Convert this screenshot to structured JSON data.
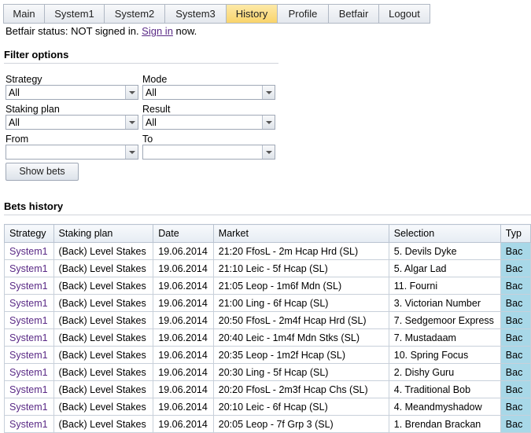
{
  "nav": {
    "tabs": [
      "Main",
      "System1",
      "System2",
      "System3",
      "History",
      "Profile",
      "Betfair",
      "Logout"
    ],
    "active": "History"
  },
  "status": {
    "prefix": "Betfair status: NOT signed in. ",
    "link": "Sign in",
    "suffix": " now."
  },
  "filter": {
    "title": "Filter options",
    "strategy": {
      "label": "Strategy",
      "value": "All"
    },
    "mode": {
      "label": "Mode",
      "value": "All"
    },
    "staking": {
      "label": "Staking plan",
      "value": "All"
    },
    "result": {
      "label": "Result",
      "value": "All"
    },
    "from": {
      "label": "From",
      "value": ""
    },
    "to": {
      "label": "To",
      "value": ""
    },
    "show_button": "Show bets"
  },
  "bets": {
    "title": "Bets history",
    "columns": [
      "Strategy",
      "Staking plan",
      "Date",
      "Market",
      "Selection",
      "Typ"
    ],
    "rows": [
      [
        "System1",
        "(Back) Level Stakes",
        "19.06.2014",
        "21:20 FfosL - 2m Hcap Hrd (SL)",
        "5. Devils Dyke",
        "Bac"
      ],
      [
        "System1",
        "(Back) Level Stakes",
        "19.06.2014",
        "21:10 Leic - 5f Hcap (SL)",
        "5. Algar Lad",
        "Bac"
      ],
      [
        "System1",
        "(Back) Level Stakes",
        "19.06.2014",
        "21:05 Leop - 1m6f Mdn (SL)",
        "11. Fourni",
        "Bac"
      ],
      [
        "System1",
        "(Back) Level Stakes",
        "19.06.2014",
        "21:00 Ling - 6f Hcap (SL)",
        "3. Victorian Number",
        "Bac"
      ],
      [
        "System1",
        "(Back) Level Stakes",
        "19.06.2014",
        "20:50 FfosL - 2m4f Hcap Hrd (SL)",
        "7. Sedgemoor Express",
        "Bac"
      ],
      [
        "System1",
        "(Back) Level Stakes",
        "19.06.2014",
        "20:40 Leic - 1m4f Mdn Stks (SL)",
        "7. Mustadaam",
        "Bac"
      ],
      [
        "System1",
        "(Back) Level Stakes",
        "19.06.2014",
        "20:35 Leop - 1m2f Hcap (SL)",
        "10. Spring Focus",
        "Bac"
      ],
      [
        "System1",
        "(Back) Level Stakes",
        "19.06.2014",
        "20:30 Ling - 5f Hcap (SL)",
        "2. Dishy Guru",
        "Bac"
      ],
      [
        "System1",
        "(Back) Level Stakes",
        "19.06.2014",
        "20:20 FfosL - 2m3f Hcap Chs (SL)",
        "4. Traditional Bob",
        "Bac"
      ],
      [
        "System1",
        "(Back) Level Stakes",
        "19.06.2014",
        "20:10 Leic - 6f Hcap (SL)",
        "4. Meandmyshadow",
        "Bac"
      ],
      [
        "System1",
        "(Back) Level Stakes",
        "19.06.2014",
        "20:05 Leop - 7f Grp 3 (SL)",
        "1. Brendan Brackan",
        "Bac"
      ]
    ]
  }
}
